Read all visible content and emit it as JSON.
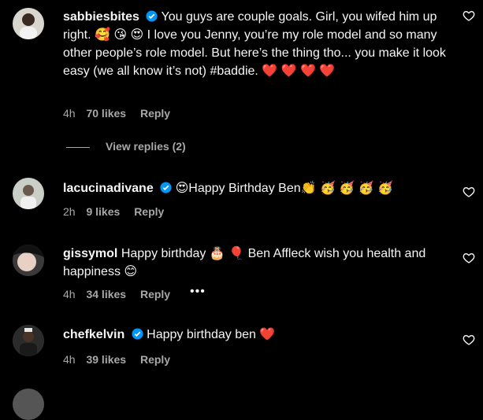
{
  "comments": [
    {
      "username": "sabbiesbites",
      "verified": true,
      "text": "You guys are couple goals. Girl, you wifed him up right. 🥰 😘 😍  I love you Jenny, you’re my role model and so many other people’s role model. But here’s the thing tho... you make it look easy (we all know it’s not) #baddie. ❤️ ❤️ ❤️ ❤️",
      "age": "4h",
      "likes": "70 likes",
      "reply": "Reply"
    },
    {
      "username": "lacucinadivane",
      "verified": true,
      "text": "😍Happy Birthday Ben👏 🥳 🥳 🥳 🥳",
      "age": "2h",
      "likes": "9 likes",
      "reply": "Reply"
    },
    {
      "username": "gissymol",
      "verified": false,
      "text": "Happy birthday 🎂 🎈 Ben Affleck wish you health and happiness 😊",
      "age": "4h",
      "likes": "34 likes",
      "reply": "Reply",
      "more": "•••"
    },
    {
      "username": "chefkelvin",
      "verified": true,
      "text": "Happy birthday ben ❤️",
      "age": "4h",
      "likes": "39 likes",
      "reply": "Reply"
    }
  ],
  "view_replies": "View replies (2)",
  "colors": {
    "background": "#000000",
    "text": "#f5f5f5",
    "muted": "#a8a8a8",
    "verified": "#0095f6"
  }
}
